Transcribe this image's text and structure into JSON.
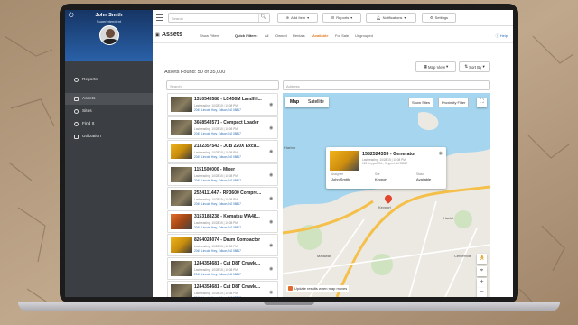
{
  "user": {
    "name": "John Smith",
    "role": "Superintendent"
  },
  "sidebar": {
    "items": [
      {
        "label": "Reports"
      },
      {
        "label": "Assets"
      },
      {
        "label": "Sites"
      },
      {
        "label": "Find It"
      },
      {
        "label": "Utilization"
      }
    ]
  },
  "topbar": {
    "search_placeholder": "Search",
    "add_label": "Add Item",
    "reports_label": "Reports",
    "notifications_label": "Notifications",
    "settings_label": "Settings"
  },
  "page": {
    "title": "Assets",
    "show_filters": "Show Filters",
    "quick_filters_label": "Quick Filters:",
    "quick_filters": [
      "All",
      "Owned",
      "Rentals",
      "Available",
      "For Sale",
      "Ungrouped"
    ],
    "help": "Help",
    "found": "Assets Found: 50 of 35,000",
    "map_view": "Map View",
    "sort_by": "Sort By",
    "list_search_placeholder": "Search",
    "address_placeholder": "Address"
  },
  "assets": [
    {
      "title": "1310545588 - LC450M Landfill...",
      "sub": "Last reading: 10/28/15 | 10:08 PM",
      "addr": "2045 Lincoln Hwy, Edison, NJ 08817",
      "thumb": "dark"
    },
    {
      "title": "3668543571 - Compact Loader",
      "sub": "Last reading: 10/28/15 | 10:08 PM",
      "addr": "2045 Lincoln Hwy, Edison, NJ 08817",
      "thumb": "dark"
    },
    {
      "title": "2132357543 - JCB 220X Exca...",
      "sub": "Last reading: 10/28/15 | 10:08 PM",
      "addr": "2045 Lincoln Hwy, Edison, NJ 08817",
      "thumb": "yellow"
    },
    {
      "title": "1151500000 - Mixer",
      "sub": "Last reading: 10/28/15 | 10:08 PM",
      "addr": "2045 Lincoln Hwy, Edison, NJ 08817",
      "thumb": "dark"
    },
    {
      "title": "2524111447 - RP3600 Compre...",
      "sub": "Last reading: 10/28/15 | 10:08 PM",
      "addr": "2045 Lincoln Hwy, Edison, NJ 08817",
      "thumb": "dark"
    },
    {
      "title": "3153188238 - Komatsu WA48...",
      "sub": "Last reading: 10/28/15 | 10:08 PM",
      "addr": "2045 Lincoln Hwy, Edison, NJ 08817",
      "thumb": "orange"
    },
    {
      "title": "8264024074 - Drum Compactor",
      "sub": "Last reading: 10/28/15 | 10:08 PM",
      "addr": "2045 Lincoln Hwy, Edison, NJ 08817",
      "thumb": "yellow"
    },
    {
      "title": "1244354681 - Cat D8T Crawle...",
      "sub": "Last reading: 10/28/15 | 10:08 PM",
      "addr": "2045 Lincoln Hwy, Edison, NJ 08817",
      "thumb": "dark"
    },
    {
      "title": "1244354681 - Cat D8T Crawle...",
      "sub": "Last reading: 10/28/15 | 10:08 PM",
      "addr": "2045 Lincoln Hwy, Edison, NJ 08817",
      "thumb": "dark"
    }
  ],
  "map": {
    "type_map": "Map",
    "type_satellite": "Satellite",
    "show_sites": "Show Sites",
    "proximity_filter": "Proximity Filter",
    "popup": {
      "title": "1582524359 - Generator",
      "sub": "Last reading: 10/28/15 | 10:08 PM",
      "addr": "123 Keyport Rd., Keyport NJ 08817",
      "assignee_label": "Assignee",
      "assignee": "John Smith",
      "site_label": "Site",
      "site": "Keyport",
      "status_label": "Status",
      "status": "Available"
    },
    "labels": [
      "Keyport",
      "Hazlet",
      "Matawan",
      "Centerville",
      "Harbor"
    ],
    "update_toggle": "Update results when map moves"
  },
  "colors": {
    "accent": "#e07b22",
    "sidebar": "#3b3e42",
    "profile": "#1f4a8c",
    "water": "#9fd2ee"
  }
}
